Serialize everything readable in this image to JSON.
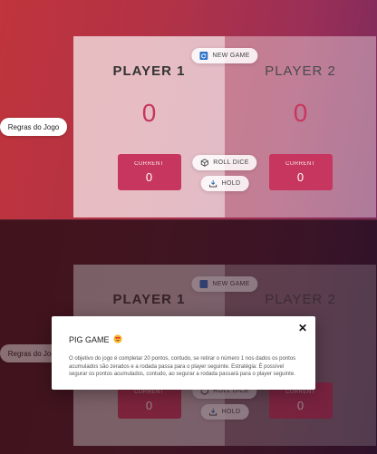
{
  "game": {
    "new_game_label": "NEW GAME",
    "roll_dice_label": "ROLL DICE",
    "hold_label": "HOLD",
    "rules_button_label": "Regras do Jogo",
    "players": [
      {
        "name": "PLAYER 1",
        "score": "0",
        "current_label": "CURRENT",
        "current": "0",
        "active": true
      },
      {
        "name": "PLAYER 2",
        "score": "0",
        "current_label": "CURRENT",
        "current": "0",
        "active": false
      }
    ]
  },
  "modal": {
    "title": "PIG GAME",
    "title_icon": "heart-eyes-emoji",
    "text": "O objetivo do jogo é completar 20 pontos, contudo, se retirar o número 1 nos dados os pontos acumulados são zerados e a rodada passa para o player seguinte. Estratégia: É possível segurar os pontos acumulados, contudo, ao segurar a rodada passará para o player seguinte.",
    "close_symbol": "✕"
  },
  "colors": {
    "accent": "#c7365f",
    "background_top": "#b23246",
    "background_dimmed": "#4a1826"
  }
}
